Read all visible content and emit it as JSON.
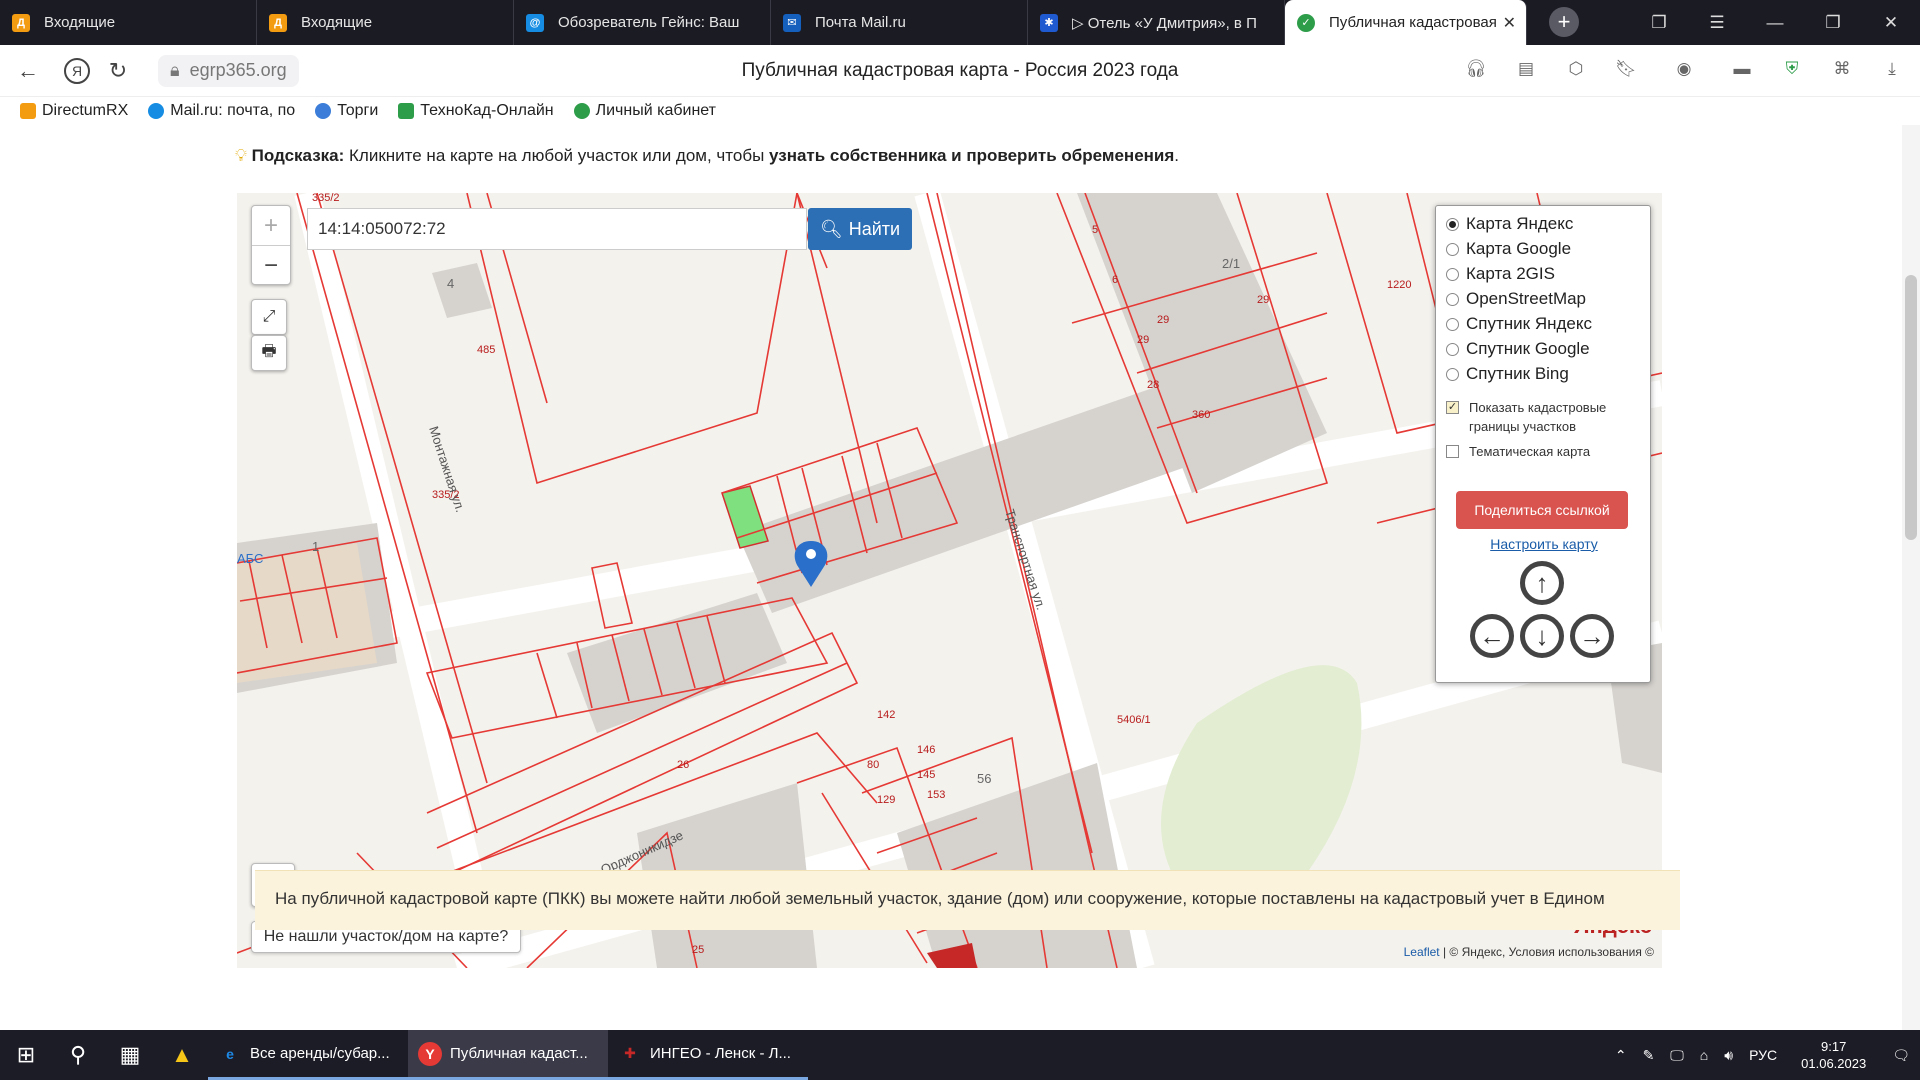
{
  "tabs": [
    {
      "title": "Входящие",
      "icon": "directum-icon",
      "color": "#f39c12"
    },
    {
      "title": "Входящие",
      "icon": "directum-icon",
      "color": "#f39c12"
    },
    {
      "title": "Обозреватель Гейнс: Ваш",
      "icon": "mailru-icon",
      "color": "#168de2"
    },
    {
      "title": "Почта Mail.ru",
      "icon": "mail-icon",
      "color": "#1560bd"
    },
    {
      "title": "▷ Отель «У Дмитрия», в П",
      "icon": "gear-icon",
      "color": "#1f5ad1"
    },
    {
      "title": "Публичная кадастровая",
      "icon": "check-icon",
      "color": "#2e9d4a",
      "active": true
    }
  ],
  "address": {
    "url": "egrp365.org",
    "title": "Публичная кадастровая карта - Россия 2023 года"
  },
  "bookmarks": [
    {
      "label": "DirectumRX",
      "color": "#f39c12"
    },
    {
      "label": "Mail.ru: почта, по",
      "color": "#168de2"
    },
    {
      "label": "Торги",
      "color": "#3b7dd8"
    },
    {
      "label": "ТехноКад-Онлайн",
      "color": "#2e9d4a"
    },
    {
      "label": "Личный кабинет",
      "color": "#2e9d4a"
    }
  ],
  "hint": {
    "prefix": "Подсказка:",
    "text": " Кликните на карте на любой участок или дом, чтобы ",
    "bold": "узнать собственника и проверить обременения",
    "suffix": "."
  },
  "map": {
    "search_value": "14:14:050072:72",
    "find_label": "Найти",
    "not_found_label": "Не нашли участок/дом на карте?",
    "copyright_leaflet": "Leaflet",
    "copyright_rest": " | © Яндекс, Условия использования ©",
    "yandex_logo": "Яндекс",
    "layers": [
      {
        "label": "Карта Яндекс",
        "selected": true
      },
      {
        "label": "Карта Google",
        "selected": false
      },
      {
        "label": "Карта 2GIS",
        "selected": false
      },
      {
        "label": "OpenStreetMap",
        "selected": false
      },
      {
        "label": "Спутник Яндекс",
        "selected": false
      },
      {
        "label": "Спутник Google",
        "selected": false
      },
      {
        "label": "Спутник Bing",
        "selected": false
      }
    ],
    "show_borders_label": "Показать кадастровые границы участков",
    "thematic_label": "Тематическая карта",
    "share_label": "Поделиться ссылкой",
    "configure_label": "Настроить карту",
    "labels": {
      "street1": "Монтажная ул.",
      "street2": "Транспортная ул.",
      "street3": "ул. Орджоникидзе",
      "absc": "АБС"
    }
  },
  "info_text": "На публичной кадастровой карте (ПКК) вы можете найти любой земельный участок, здание (дом) или сооружение, которые поставлены на кадастровый учет в Едином",
  "taskbar": {
    "apps": [
      {
        "label": "Все аренды/субар...",
        "icon": "ie-icon",
        "color": "#1e88e5"
      },
      {
        "label": "Публичная кадаст...",
        "icon": "yandex-browser-icon",
        "color": "#e53935",
        "active": true
      },
      {
        "label": "ИНГЕО - Ленск - Л...",
        "icon": "ingeo-icon",
        "color": "#c62828"
      }
    ],
    "lang": "РУС",
    "time": "9:17",
    "date": "01.06.2023"
  }
}
